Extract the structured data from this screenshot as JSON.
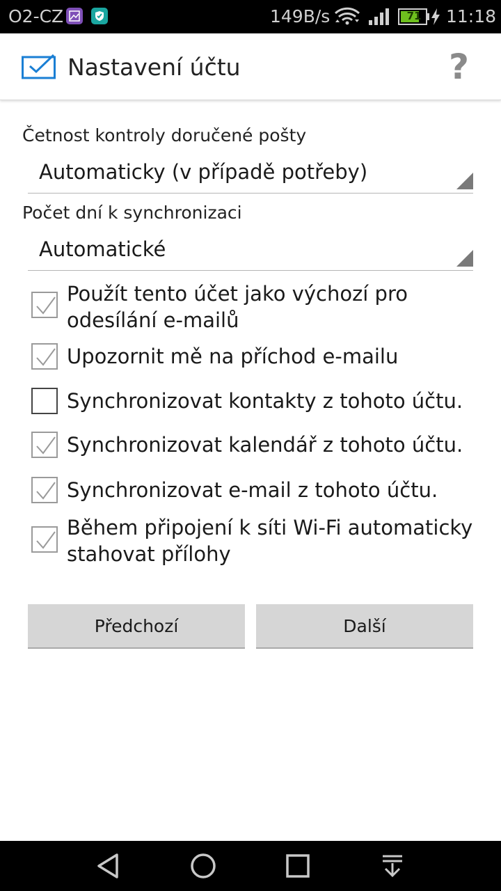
{
  "status_bar": {
    "carrier": "O2-CZ",
    "net_speed": "149B/s",
    "battery_level": "71",
    "time": "11:18",
    "icons": [
      "gallery-icon",
      "shield-icon",
      "wifi-icon",
      "signal-icon",
      "battery-icon",
      "charging-icon"
    ]
  },
  "app_bar": {
    "title": "Nastavení účtu",
    "icons": [
      "mail-icon",
      "help-icon"
    ]
  },
  "form": {
    "check_frequency": {
      "label": "Četnost kontroly doručené pošty",
      "value": "Automaticky (v případě potřeby)"
    },
    "sync_days": {
      "label": "Počet dní k synchronizaci",
      "value": "Automatické"
    },
    "options": [
      {
        "label": "Použít tento účet jako výchozí pro odesílání e-mailů",
        "checked": true
      },
      {
        "label": "Upozornit mě na příchod e-mailu",
        "checked": true
      },
      {
        "label": "Synchronizovat kontakty z tohoto účtu.",
        "checked": false
      },
      {
        "label": "Synchronizovat kalendář z tohoto účtu.",
        "checked": true
      },
      {
        "label": "Synchronizovat e-mail z tohoto účtu.",
        "checked": true
      },
      {
        "label": "Během připojení k síti Wi-Fi automaticky stahovat přílohy",
        "checked": true
      }
    ]
  },
  "buttons": {
    "previous": "Předchozí",
    "next": "Další"
  },
  "nav_bar": {
    "icons": [
      "back-icon",
      "home-icon",
      "recents-icon",
      "notification-pull-icon"
    ]
  },
  "colors": {
    "accent": "#1a7fd4",
    "button_bg": "#d6d6d6",
    "status_bar_bg": "#000000"
  }
}
